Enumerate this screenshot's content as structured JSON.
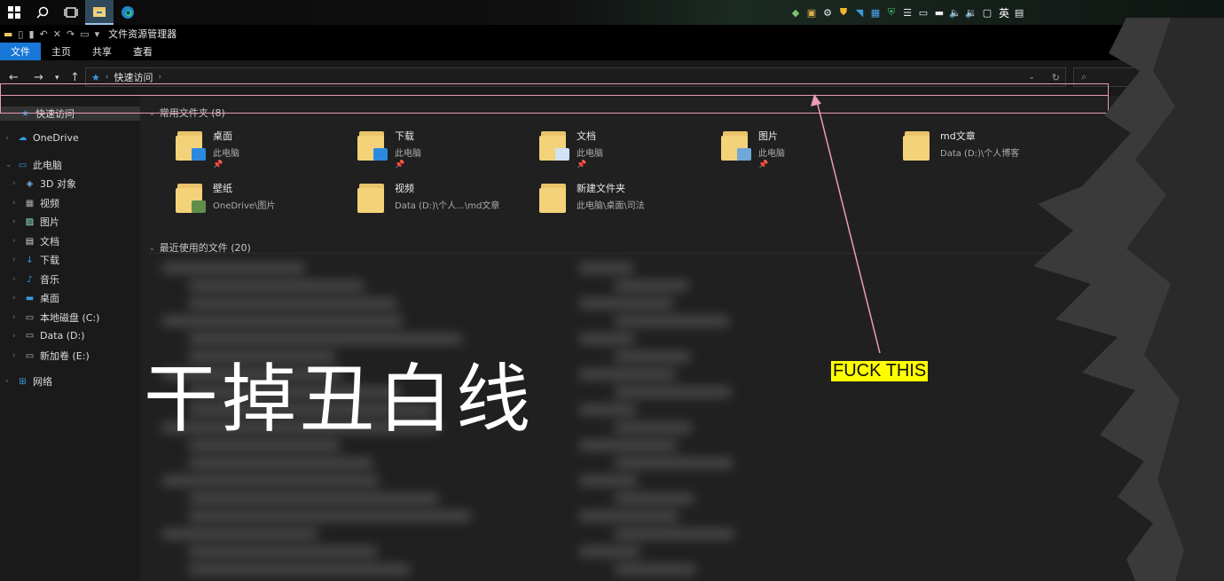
{
  "taskbar": {
    "icons": [
      "windows-start-icon",
      "search-icon",
      "task-view-icon",
      "file-explorer-icon",
      "edge-icon"
    ],
    "tray_icons": [
      "app-icon",
      "app-icon",
      "network-icon",
      "shield-icon",
      "app-icon",
      "app-icon",
      "security-icon",
      "wifi-icon",
      "battery-icon",
      "usb-icon",
      "volume-icon",
      "volume-icon",
      "monitor-icon"
    ],
    "ime": "英"
  },
  "window": {
    "title": "文件资源管理器"
  },
  "ribbon": {
    "tabs": [
      "文件",
      "主页",
      "共享",
      "查看"
    ],
    "active_tab": "文件"
  },
  "navbar": {
    "address": "快速访问"
  },
  "sidebar": {
    "items": [
      {
        "label": "快速访问",
        "icon": "star-icon",
        "level": 0
      },
      {
        "label": "OneDrive",
        "icon": "cloud-icon",
        "level": 0
      },
      {
        "label": "此电脑",
        "icon": "computer-icon",
        "level": 0
      },
      {
        "label": "3D 对象",
        "icon": "cube-icon",
        "level": 1
      },
      {
        "label": "视频",
        "icon": "video-icon",
        "level": 1
      },
      {
        "label": "图片",
        "icon": "picture-icon",
        "level": 1
      },
      {
        "label": "文档",
        "icon": "document-icon",
        "level": 1
      },
      {
        "label": "下载",
        "icon": "download-icon",
        "level": 1
      },
      {
        "label": "音乐",
        "icon": "music-icon",
        "level": 1
      },
      {
        "label": "桌面",
        "icon": "desktop-icon",
        "level": 1
      },
      {
        "label": "本地磁盘 (C:)",
        "icon": "drive-icon",
        "level": 1
      },
      {
        "label": "Data (D:)",
        "icon": "drive-icon",
        "level": 1
      },
      {
        "label": "新加卷 (E:)",
        "icon": "drive-icon",
        "level": 1
      },
      {
        "label": "网络",
        "icon": "network-icon",
        "level": 0
      }
    ]
  },
  "content": {
    "frequent_header": "常用文件夹 (8)",
    "recent_header": "最近使用的文件 (20)",
    "folders": [
      {
        "name": "桌面",
        "sub": "此电脑",
        "pinned": true,
        "badge": "desktop"
      },
      {
        "name": "下载",
        "sub": "此电脑",
        "pinned": true,
        "badge": "download"
      },
      {
        "name": "文档",
        "sub": "此电脑",
        "pinned": true,
        "badge": "document"
      },
      {
        "name": "图片",
        "sub": "此电脑",
        "pinned": true,
        "badge": "picture"
      },
      {
        "name": "md文章",
        "sub": "Data (D:)\\个人博客",
        "pinned": false,
        "badge": "none"
      },
      {
        "name": "壁纸",
        "sub": "OneDrive\\图片",
        "pinned": false,
        "badge": "image"
      },
      {
        "name": "视频",
        "sub": "Data (D:)\\个人...\\md文章",
        "pinned": false,
        "badge": "none"
      },
      {
        "name": "新建文件夹",
        "sub": "此电脑\\桌面\\司法",
        "pinned": false,
        "badge": "none"
      }
    ]
  },
  "overlay": {
    "big_text": "干掉丑白线",
    "annotation": "FUCK THIS"
  },
  "colors": {
    "accent": "#1878d8",
    "highlight_box": "#e89ab8",
    "annotation_bg": "#ffff00"
  }
}
